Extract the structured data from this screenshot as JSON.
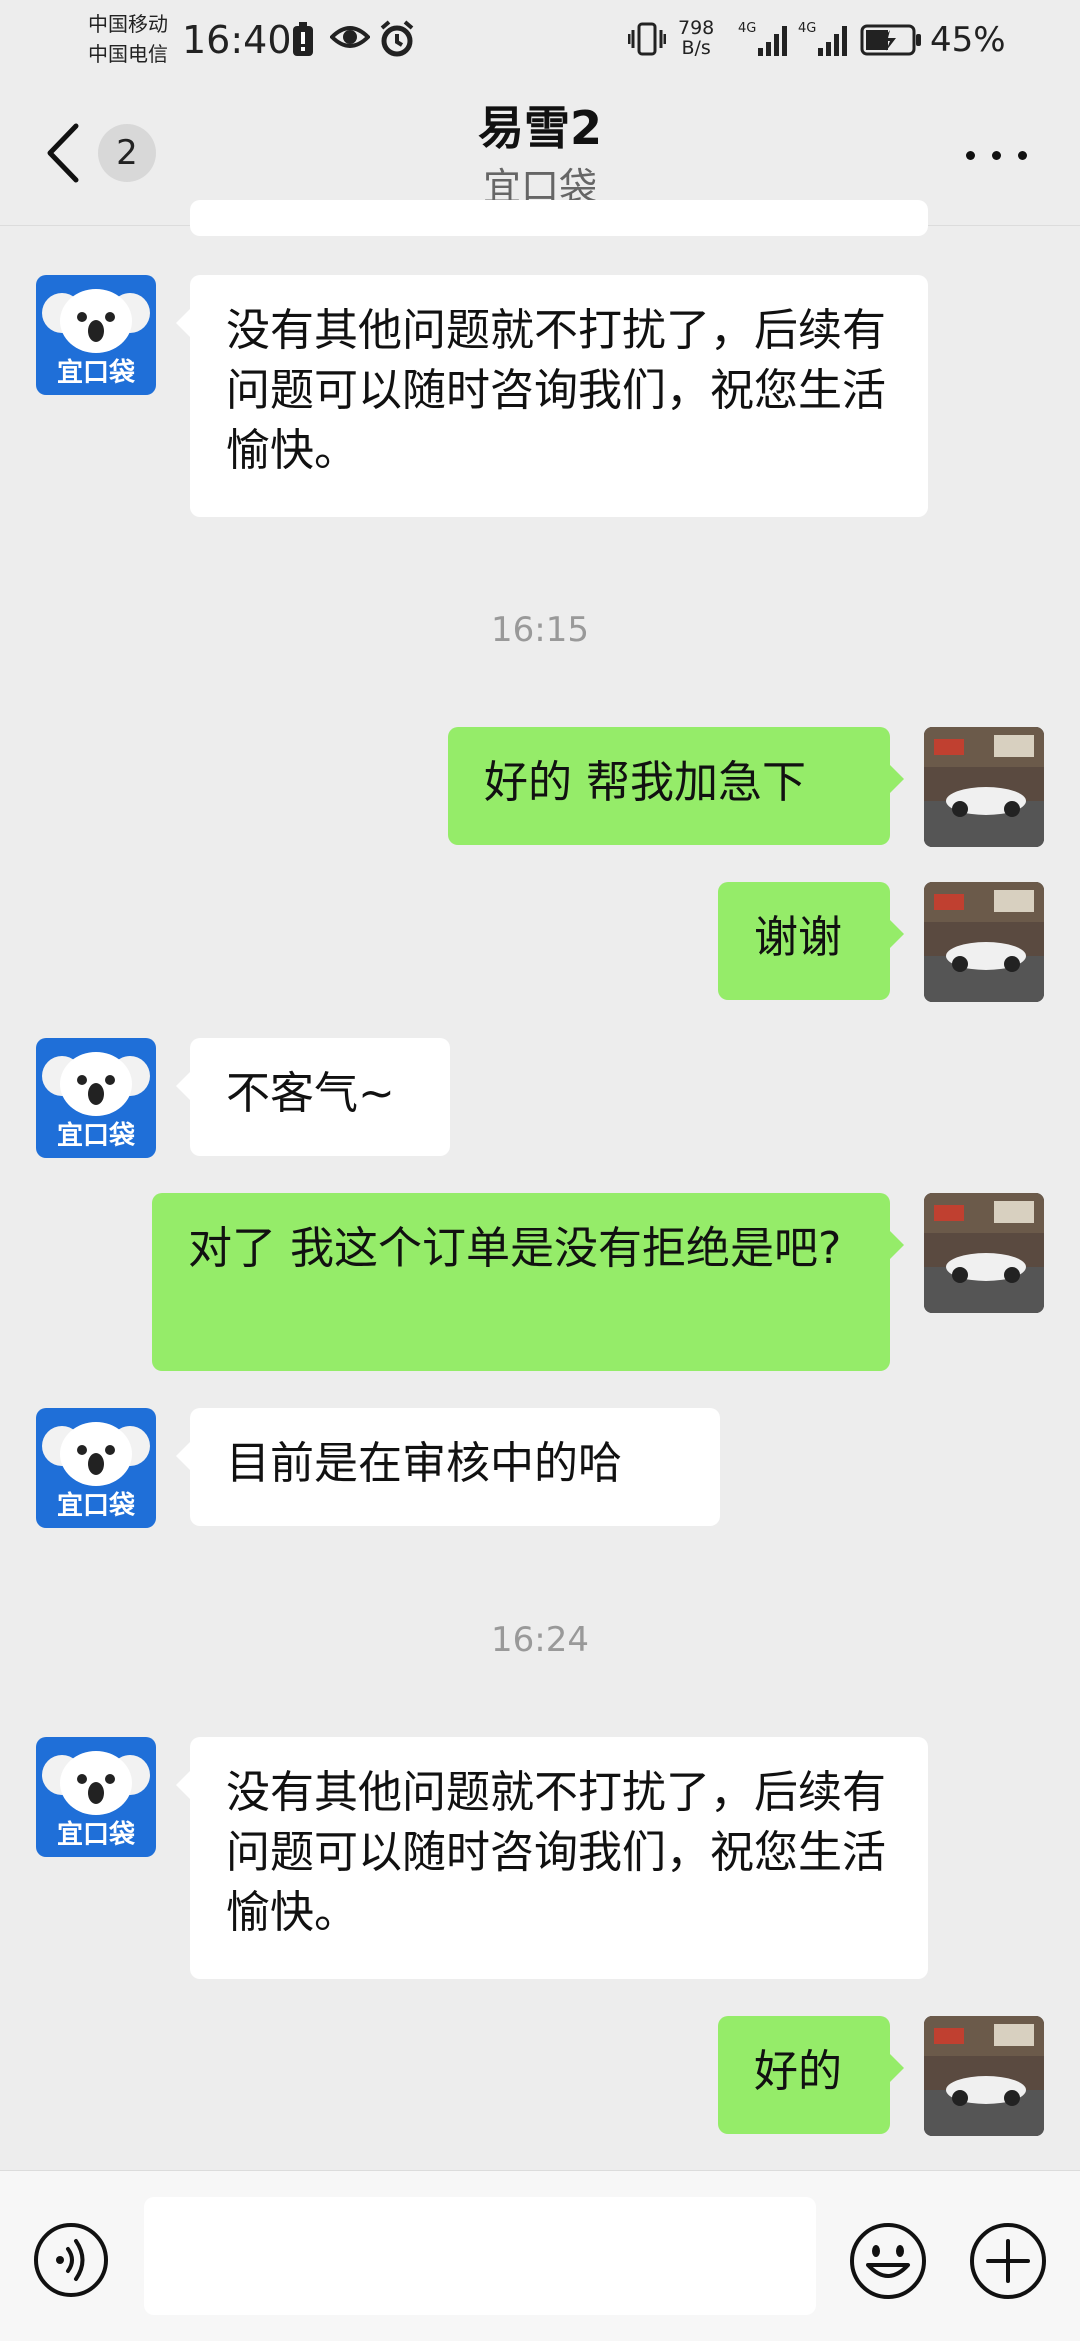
{
  "status_bar": {
    "carrier_1": "中国移动",
    "carrier_2": "中国电信",
    "time": "16:40",
    "net_speed_value": "798",
    "net_speed_unit": "B/s",
    "battery": "45%"
  },
  "nav": {
    "unread_count": "2",
    "title": "易雪2",
    "subtitle": "宜口袋"
  },
  "bot_avatar_label": "宜口袋",
  "messages": [
    {
      "side": "in",
      "text": "没有其他问题就不打扰了，后续有问题可以随时咨询我们，祝您生活愉快。"
    },
    {
      "type": "time",
      "text": "16:15"
    },
    {
      "side": "out",
      "text": "好的 帮我加急下"
    },
    {
      "side": "out",
      "text": "谢谢"
    },
    {
      "side": "in",
      "text": "不客气~"
    },
    {
      "side": "out",
      "text": "对了 我这个订单是没有拒绝是吧?"
    },
    {
      "side": "in",
      "text": "目前是在审核中的哈"
    },
    {
      "type": "time",
      "text": "16:24"
    },
    {
      "side": "in",
      "text": "没有其他问题就不打扰了，后续有问题可以随时咨询我们，祝您生活愉快。"
    },
    {
      "side": "out",
      "text": "好的"
    }
  ],
  "input": {
    "value": "",
    "placeholder": ""
  },
  "colors": {
    "background": "#ededed",
    "outgoing_bubble": "#95ec69",
    "incoming_bubble": "#ffffff",
    "bot_avatar": "#1f6fd8"
  }
}
